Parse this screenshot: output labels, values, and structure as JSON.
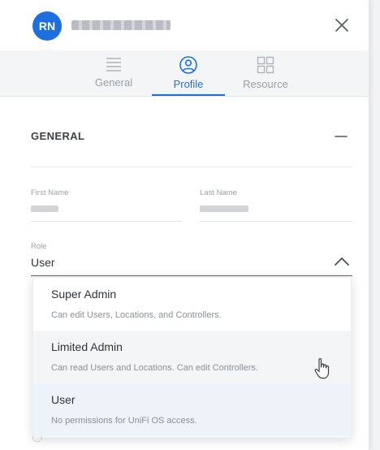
{
  "header": {
    "avatar_initials": "RN"
  },
  "tabs": [
    {
      "label": "General",
      "icon": "list-icon",
      "active": false
    },
    {
      "label": "Profile",
      "icon": "user-circle-icon",
      "active": true
    },
    {
      "label": "Resource",
      "icon": "grid-icon",
      "active": false
    }
  ],
  "section": {
    "title": "GENERAL"
  },
  "fields": {
    "first_name_label": "First Name",
    "last_name_label": "Last Name",
    "role_label": "Role",
    "role_value": "User"
  },
  "role_options": [
    {
      "title": "Super Admin",
      "description": "Can edit Users, Locations, and Controllers."
    },
    {
      "title": "Limited Admin",
      "description": "Can read Users and Locations. Can edit Controllers."
    },
    {
      "title": "User",
      "description": "No permissions for UniFi OS access."
    }
  ],
  "colors": {
    "accent": "#1c6fe0",
    "hover_row": "#f4f5f7",
    "selected_row": "#eef3fa"
  }
}
